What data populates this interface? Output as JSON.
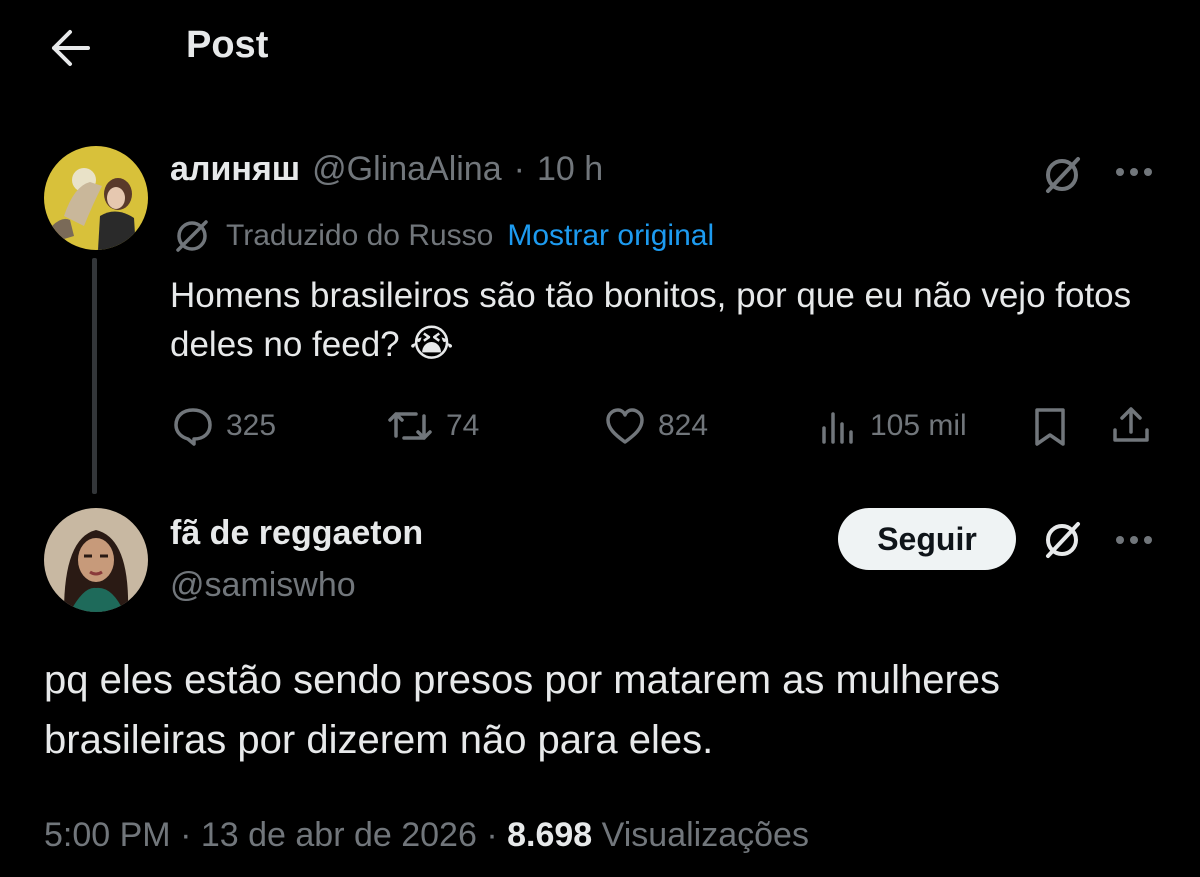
{
  "header": {
    "title": "Post"
  },
  "parent_tweet": {
    "display_name": "алиняш",
    "handle": "@GlinaAlina",
    "separator": "·",
    "time": "10 h",
    "translation_label": "Traduzido do Russo",
    "show_original": "Mostrar original",
    "text": "Homens brasileiros são tão bonitos, por que eu não vejo fotos deles no feed?",
    "emoji": "😭",
    "replies": "325",
    "retweets": "74",
    "likes": "824",
    "views": "105 mil"
  },
  "main_tweet": {
    "display_name": "fã de reggaeton",
    "handle": "@samiswho",
    "follow_label": "Seguir",
    "text_line1": "pq eles estão sendo presos por matarem as mulheres",
    "text_line2": "brasileiras por dizerem não para eles.",
    "time": "5:00 PM",
    "dot": "·",
    "date": "13 de abr de 2026",
    "views_count": "8.698",
    "views_label": "Visualizações"
  },
  "colors": {
    "background": "#000000",
    "text": "#e7e9ea",
    "muted": "#71767b",
    "link": "#1d9bf0",
    "follow_bg": "#eff3f4"
  },
  "icons": [
    "back-arrow-icon",
    "grok-icon",
    "more-icon",
    "translate-icon",
    "reply-icon",
    "retweet-icon",
    "like-icon",
    "views-icon",
    "bookmark-icon",
    "share-icon"
  ]
}
